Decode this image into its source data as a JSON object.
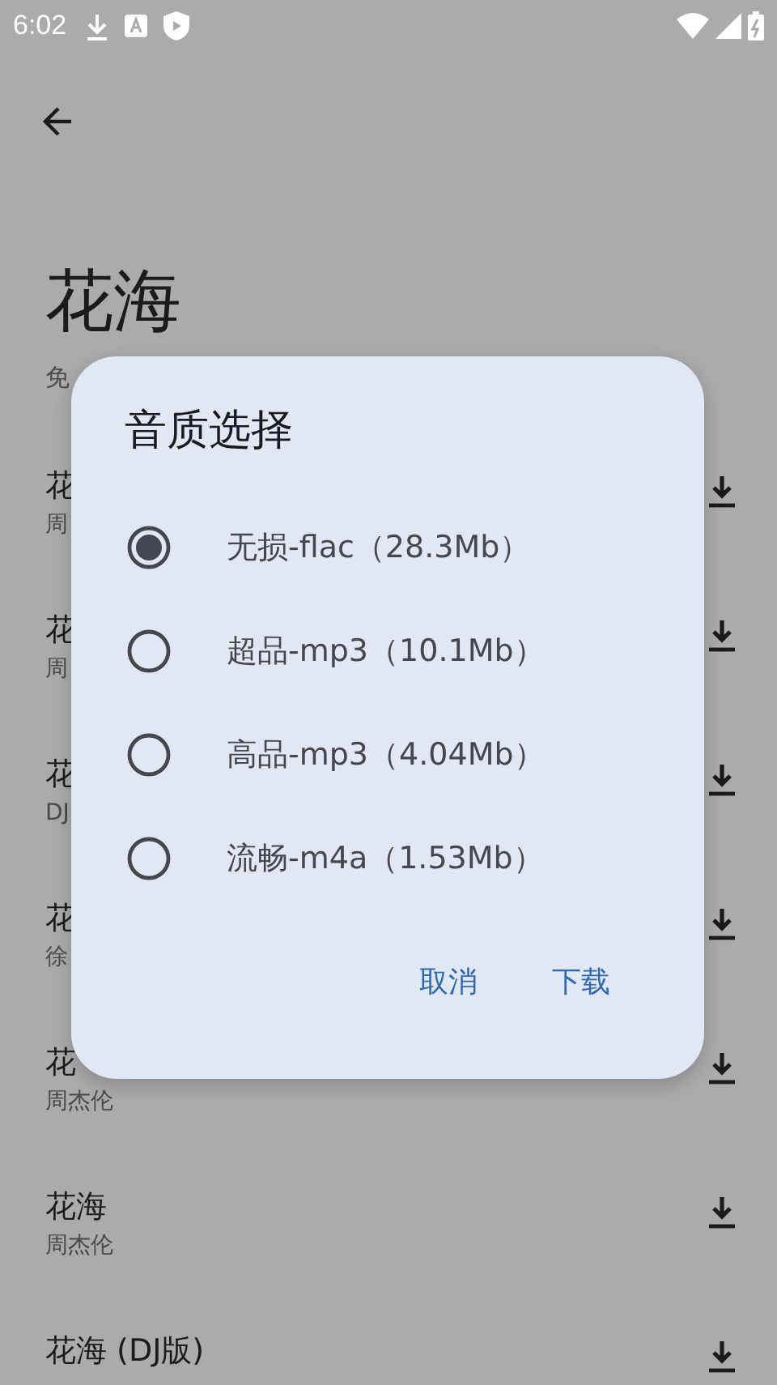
{
  "status_bar": {
    "time": "6:02"
  },
  "page": {
    "title": "花海",
    "subtitle": "免"
  },
  "songs": [
    {
      "title": "花",
      "artist": "周"
    },
    {
      "title": "花",
      "artist": "周"
    },
    {
      "title": "花",
      "artist": "DJ"
    },
    {
      "title": "花",
      "artist": "徐"
    },
    {
      "title": "花",
      "artist": "周杰伦"
    },
    {
      "title": "花海",
      "artist": "周杰伦"
    },
    {
      "title": "花海 (DJ版)"
    }
  ],
  "dialog": {
    "title": "音质选择",
    "options": [
      {
        "label": "无损-flac（28.3Mb）",
        "selected": true
      },
      {
        "label": "超品-mp3（10.1Mb）",
        "selected": false
      },
      {
        "label": "高品-mp3（4.04Mb）",
        "selected": false
      },
      {
        "label": "流畅-m4a（1.53Mb）",
        "selected": false
      }
    ],
    "buttons": [
      "取消",
      "下载"
    ]
  }
}
